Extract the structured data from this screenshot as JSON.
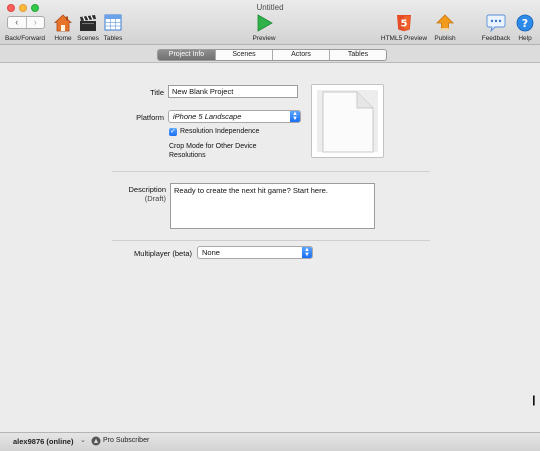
{
  "window": {
    "title": "Untitled"
  },
  "toolbar": {
    "nav_back": "‹",
    "nav_forward": "›",
    "back_forward_label": "Back/Forward",
    "home_label": "Home",
    "scenes_label": "Scenes",
    "tables_label": "Tables",
    "preview_label": "Preview",
    "html5_badge": "5",
    "html5_preview_label": "HTML5 Preview",
    "publish_label": "Publish",
    "feedback_label": "Feedback",
    "help_label": "Help",
    "help_glyph": "?",
    "feedback_glyph": "•••"
  },
  "tabs": [
    {
      "label": "Project Info",
      "active": true
    },
    {
      "label": "Scenes",
      "active": false
    },
    {
      "label": "Actors",
      "active": false
    },
    {
      "label": "Tables",
      "active": false
    }
  ],
  "project": {
    "title_label": "Title",
    "title_value": "New Blank Project",
    "platform_label": "Platform",
    "platform_value": "iPhone 5 Landscape",
    "resolution_independence_label": "Resolution Independence",
    "resolution_independence_checked": true,
    "crop_mode_label_line1": "Crop Mode for Other Device",
    "crop_mode_label_line2": "Resolutions",
    "description_label": "Description",
    "description_sublabel": "(Draft)",
    "description_value": "Ready to create the next hit game?  Start here.",
    "multiplayer_label": "Multiplayer (beta)",
    "multiplayer_value": "None"
  },
  "status": {
    "user": "alex9876 (online)",
    "chevron": "⌄",
    "subscription": "Pro Subscriber"
  },
  "icons": {
    "home": "home-icon",
    "scenes": "clapperboard-icon",
    "tables": "table-icon",
    "preview": "play-icon",
    "html5": "html5-icon",
    "publish": "upload-icon",
    "feedback": "speech-bubble-icon",
    "help": "help-icon"
  },
  "colors": {
    "accent_blue": "#1a6ff2",
    "play_green": "#2fb24a",
    "html5_orange": "#e44d26",
    "publish_orange": "#f29a1c"
  }
}
